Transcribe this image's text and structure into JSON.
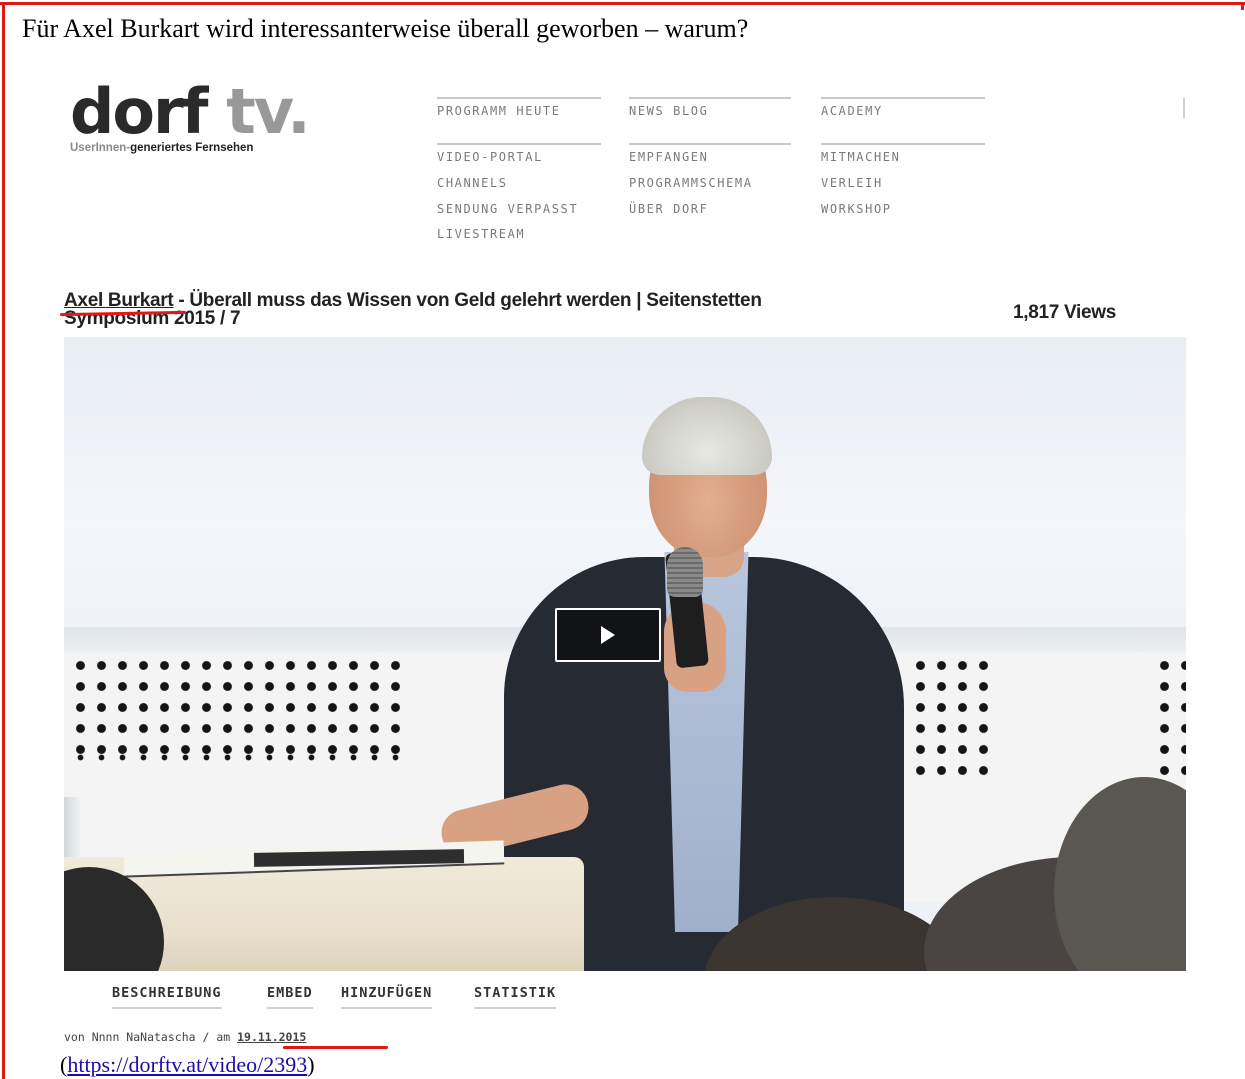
{
  "doc": {
    "heading": "Für Axel Burkart wird interessanterweise überall geworben – warum?",
    "source_open": "(",
    "source_url": "https://dorftv.at/video/2393",
    "source_close": ")"
  },
  "logo": {
    "word": "dorf",
    "suffix": "tv.",
    "tagline_light": "UserInnen-",
    "tagline_bold": "generiertes Fernsehen"
  },
  "nav": {
    "col1": [
      "PROGRAMM HEUTE",
      "VIDEO-PORTAL",
      "CHANNELS",
      "SENDUNG VERPASST",
      "LIVESTREAM"
    ],
    "col2": [
      "NEWS BLOG",
      "EMPFANGEN",
      "PROGRAMMSCHEMA",
      "ÜBER DORF"
    ],
    "col3": [
      "ACADEMY",
      "MITMACHEN",
      "VERLEIH",
      "WORKSHOP"
    ]
  },
  "video": {
    "author_link": "Axel Burkart",
    "title_rest": " - Überall muss das Wissen von Geld gelehrt werden | Seitenstetten Symposium 2015 / 7",
    "views": "1,817 Views"
  },
  "tabs": [
    "BESCHREIBUNG",
    "EMBED",
    "HINZUFÜGEN",
    "STATISTIK"
  ],
  "byline": {
    "prefix": "von Nnnn NaNatascha / am ",
    "date": "19.11.2015"
  },
  "colors": {
    "annotation_red": "#e01818",
    "link_blue": "#1a0dab"
  }
}
